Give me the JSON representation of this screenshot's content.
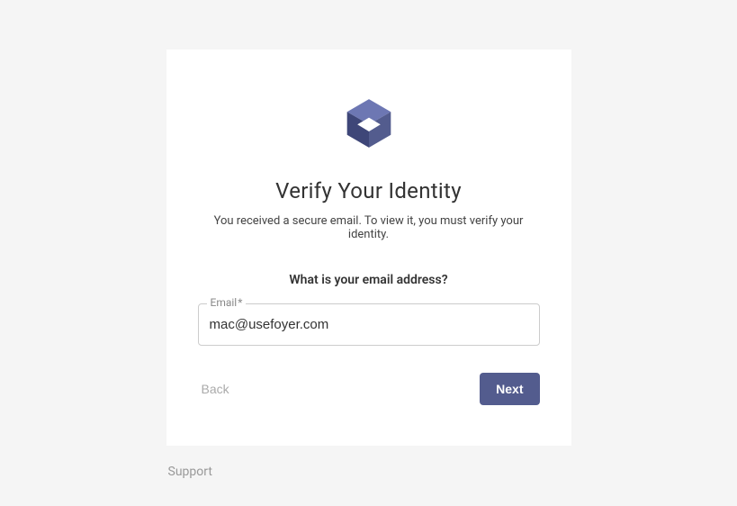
{
  "card": {
    "title": "Verify Your Identity",
    "subtitle": "You received a secure email. To view it, you must verify your identity.",
    "prompt": "What is your email address?",
    "email_label": "Email",
    "required_mark": "*",
    "email_value": "mac@usefoyer.com",
    "back_label": "Back",
    "next_label": "Next"
  },
  "footer": {
    "support_label": "Support"
  },
  "colors": {
    "accent": "#535c8e",
    "logo_light": "#6d77b3",
    "logo_dark": "#3e4678"
  }
}
